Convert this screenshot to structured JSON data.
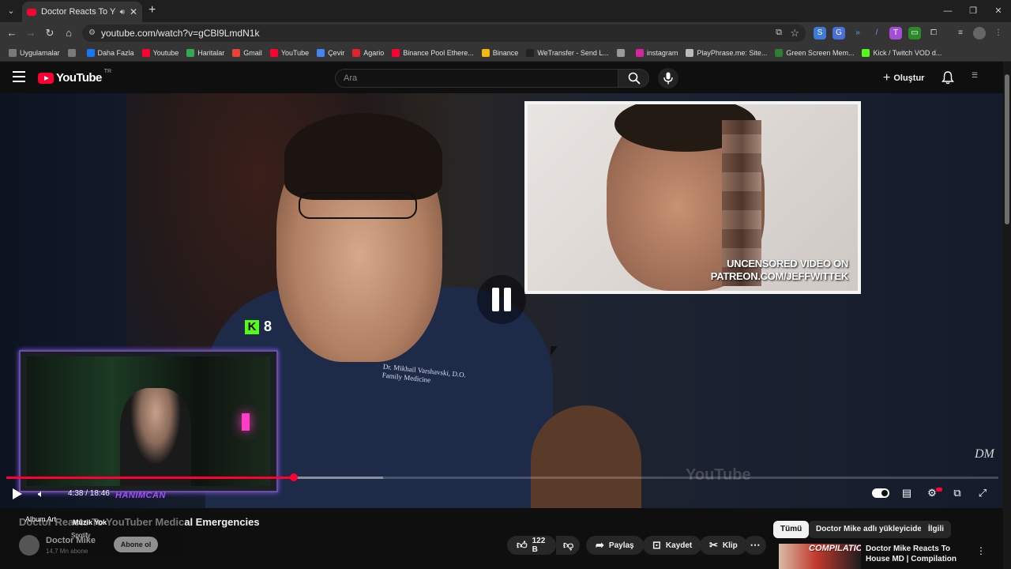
{
  "browser": {
    "tab_title": "Doctor Reacts To YouTuber",
    "url": "youtube.com/watch?v=gCBl9LmdN1k",
    "bookmarks": [
      {
        "label": "Uygulamalar",
        "color": "#7a7a7a"
      },
      {
        "label": "",
        "color": "#7a7a7a"
      },
      {
        "label": "Daha Fazla",
        "color": "#1877f2"
      },
      {
        "label": "Youtube",
        "color": "#ff0033"
      },
      {
        "label": "Haritalar",
        "color": "#34a853"
      },
      {
        "label": "Gmail",
        "color": "#ea4335"
      },
      {
        "label": "YouTube",
        "color": "#ff0033"
      },
      {
        "label": "Çevir",
        "color": "#4285f4"
      },
      {
        "label": "Agario",
        "color": "#e0242f"
      },
      {
        "label": "Binance Pool Ethere...",
        "color": "#ff0033"
      },
      {
        "label": "Binance",
        "color": "#f0b90b"
      },
      {
        "label": "WeTransfer - Send L...",
        "color": "#222222"
      },
      {
        "label": "",
        "color": "#9a9a9a"
      },
      {
        "label": "instagram",
        "color": "#d6249f"
      },
      {
        "label": "PlayPhrase.me: Site...",
        "color": "#bbbbbb"
      },
      {
        "label": "Green Screen Mem...",
        "color": "#2e7d32"
      },
      {
        "label": "Kick / Twitch VOD d...",
        "color": "#53fc18"
      }
    ]
  },
  "youtube": {
    "logo_text": "YouTube",
    "logo_country": "TR",
    "search_placeholder": "Ara",
    "create_label": "Oluştur"
  },
  "video": {
    "inset_caption_line1": "UNCENSORED VIDEO ON",
    "inset_caption_line2": "PATREON.COM/JEFFWITTEK",
    "scrubs_line1": "Dr. Mikhail Varshavski, D.O.",
    "scrubs_line2": "Family Medicine",
    "watermark": "YouTube",
    "signature": "DM",
    "kick_viewers": "8",
    "streamer_name": "HANIMCAN",
    "time_display": "4:38 / 18:46",
    "progress_fraction": 0.29,
    "buffer_fraction": 0.38
  },
  "below": {
    "title": "Doctor Reacts To YouTuber Medical Emergencies",
    "album_art": "Album Art",
    "music": "Müzik Yok",
    "spotify": "Spotify",
    "channel": "Doctor Mike",
    "subs": "14,7 Mn abone",
    "subscribe": "Abone ol",
    "likes": "122 B",
    "share": "Paylaş",
    "save": "Kaydet",
    "clip": "Klip"
  },
  "sidebar": {
    "chips": [
      "Tümü",
      "Doctor Mike adlı yükleyiciden",
      "İlgili"
    ],
    "rec_thumb_text": "COMPILATION",
    "rec_title": "Doctor Mike Reacts To House MD | Compilation"
  },
  "colors": {
    "accent": "#ff0033",
    "kick": "#53fc18",
    "cam_border": "#6b4ca6"
  }
}
